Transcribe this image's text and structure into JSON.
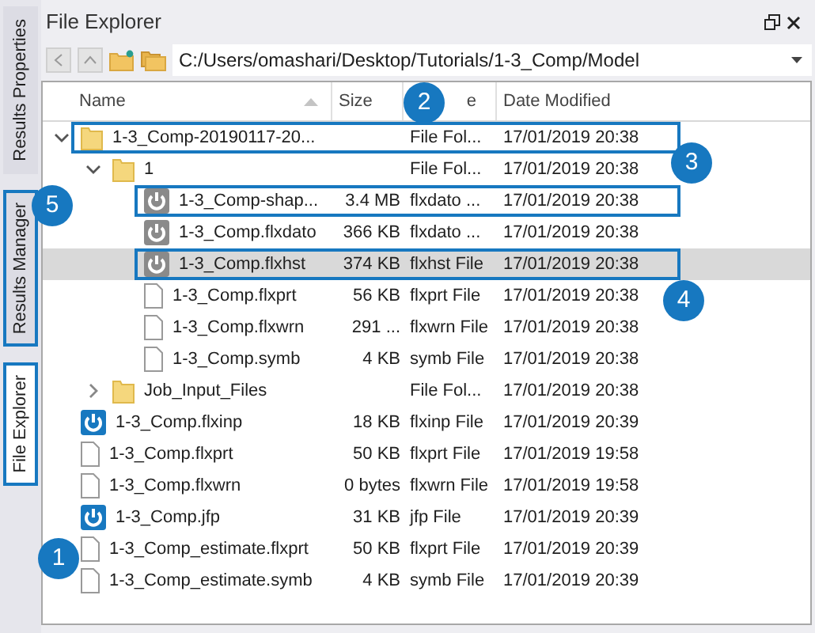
{
  "side_tabs": [
    {
      "label": "Results Properties",
      "selected": false,
      "outlined": false
    },
    {
      "label": "Results Manager",
      "selected": false,
      "outlined": true
    },
    {
      "label": "File Explorer",
      "selected": true,
      "outlined": true
    }
  ],
  "panel": {
    "title": "File Explorer",
    "path": "C:/Users/omashari/Desktop/Tutorials/1-3_Comp/Model"
  },
  "table": {
    "columns": [
      "Name",
      "Size",
      "e",
      "Date Modified"
    ],
    "rows": [
      {
        "kind": "folder",
        "name": "1-3_Comp-20190117-20...",
        "type": "File Fol...",
        "date": "17/01/2019 20:38",
        "expanded": true,
        "selected": false,
        "outlined": true,
        "children": [
          {
            "kind": "folder",
            "name": "1",
            "type": "File Fol...",
            "date": "17/01/2019 20:38",
            "expanded": true,
            "selected": false,
            "outlined": false,
            "children": [
              {
                "kind": "result",
                "name": "1-3_Comp-shap...",
                "size": "3.4 MB",
                "type": "flxdato ...",
                "date": "17/01/2019 20:38",
                "selected": false,
                "outlined": true
              },
              {
                "kind": "result",
                "name": "1-3_Comp.flxdato",
                "size": "366 KB",
                "type": "flxdato ...",
                "date": "17/01/2019 20:38",
                "selected": false,
                "outlined": false
              },
              {
                "kind": "result",
                "name": "1-3_Comp.flxhst",
                "size": "374 KB",
                "type": "flxhst File",
                "date": "17/01/2019 20:38",
                "selected": true,
                "outlined": true
              },
              {
                "kind": "doc",
                "name": "1-3_Comp.flxprt",
                "size": "56 KB",
                "type": "flxprt File",
                "date": "17/01/2019 20:38",
                "selected": false,
                "outlined": false
              },
              {
                "kind": "doc",
                "name": "1-3_Comp.flxwrn",
                "size": "291 ...",
                "type": "flxwrn File",
                "date": "17/01/2019 20:38",
                "selected": false,
                "outlined": false
              },
              {
                "kind": "doc",
                "name": "1-3_Comp.symb",
                "size": "4 KB",
                "type": "symb File",
                "date": "17/01/2019 20:38",
                "selected": false,
                "outlined": false
              }
            ]
          },
          {
            "kind": "folder",
            "name": "Job_Input_Files",
            "type": "File Fol...",
            "date": "17/01/2019 20:38",
            "expanded": false,
            "selected": false,
            "outlined": false
          }
        ]
      },
      {
        "kind": "input",
        "name": "1-3_Comp.flxinp",
        "size": "18 KB",
        "type": "flxinp File",
        "date": "17/01/2019 20:39",
        "selected": false,
        "outlined": false
      },
      {
        "kind": "doc",
        "name": "1-3_Comp.flxprt",
        "size": "50 KB",
        "type": "flxprt File",
        "date": "17/01/2019 19:58",
        "selected": false,
        "outlined": false
      },
      {
        "kind": "doc",
        "name": "1-3_Comp.flxwrn",
        "size": "0 bytes",
        "type": "flxwrn File",
        "date": "17/01/2019 19:58",
        "selected": false,
        "outlined": false
      },
      {
        "kind": "input",
        "name": "1-3_Comp.jfp",
        "size": "31 KB",
        "type": "jfp File",
        "date": "17/01/2019 20:39",
        "selected": false,
        "outlined": false
      },
      {
        "kind": "doc",
        "name": "1-3_Comp_estimate.flxprt",
        "size": "50 KB",
        "type": "flxprt File",
        "date": "17/01/2019 20:39",
        "selected": false,
        "outlined": false
      },
      {
        "kind": "doc",
        "name": "1-3_Comp_estimate.symb",
        "size": "4 KB",
        "type": "symb File",
        "date": "17/01/2019 20:39",
        "selected": false,
        "outlined": false
      }
    ]
  },
  "badges": [
    {
      "label": "1"
    },
    {
      "label": "2"
    },
    {
      "label": "3"
    },
    {
      "label": "4"
    },
    {
      "label": "5"
    }
  ]
}
